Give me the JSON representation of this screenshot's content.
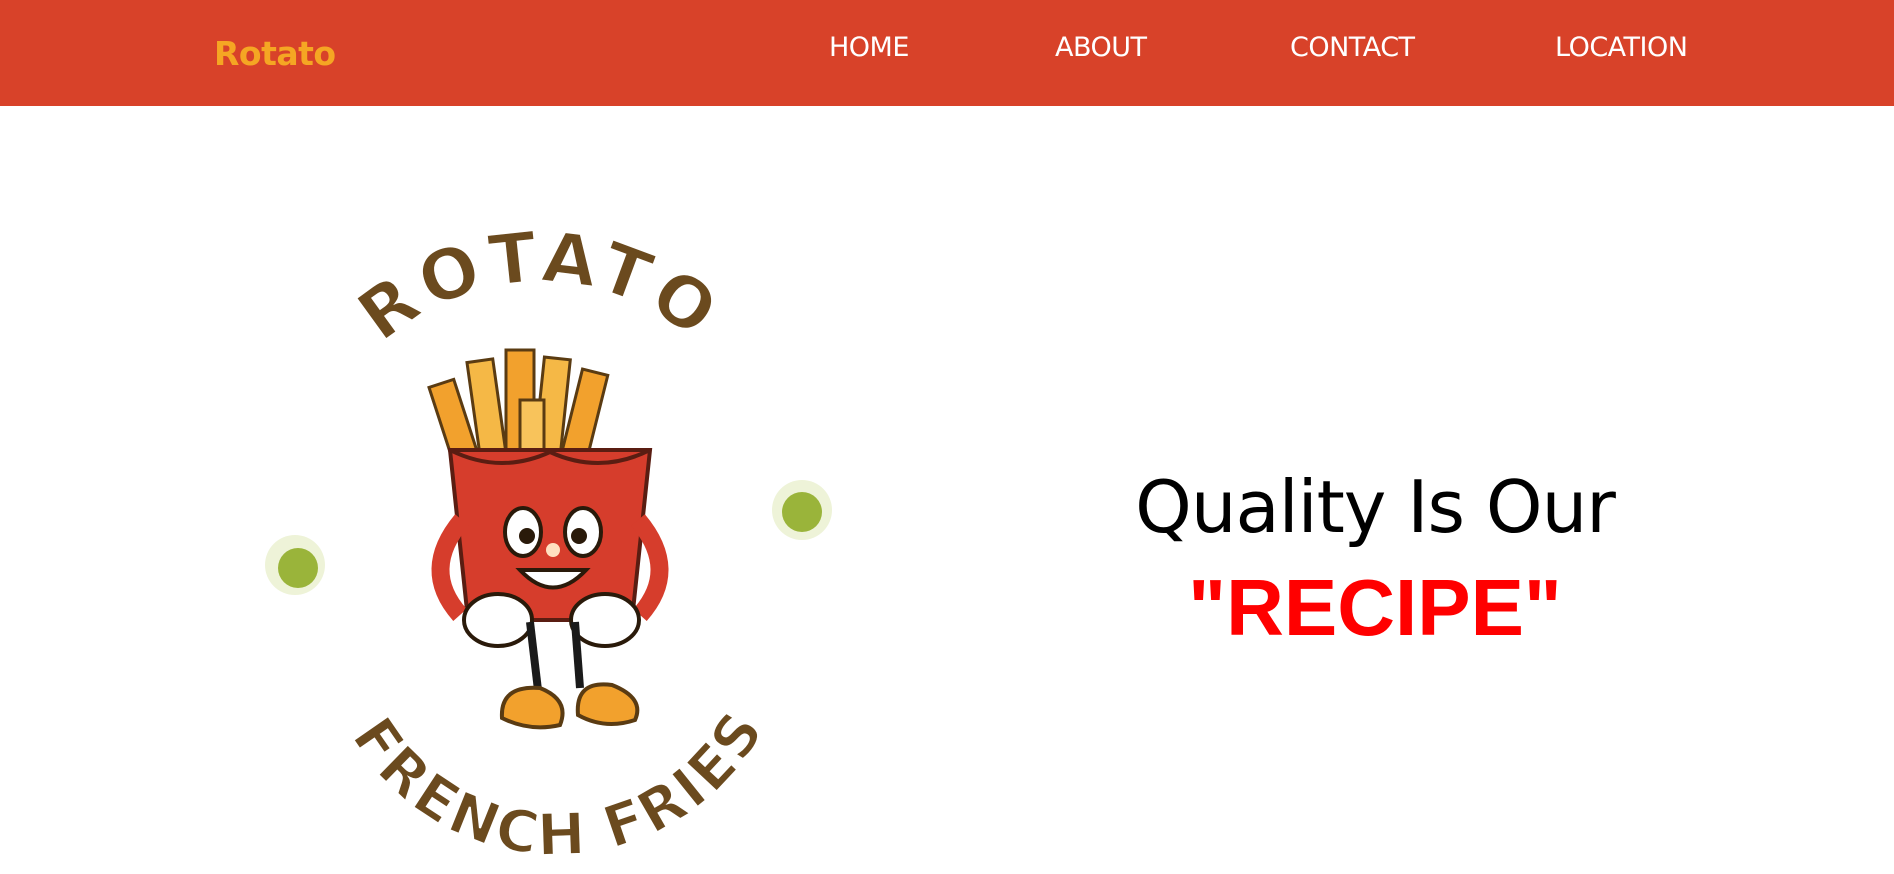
{
  "nav": {
    "brand": "Rotato",
    "links": [
      "HOME",
      "ABOUT",
      "CONTACT",
      "LOCATION"
    ]
  },
  "hero": {
    "logo": {
      "top_text": "ROTATO",
      "bottom_text": "FRENCH FRIES"
    },
    "headline": "Quality Is Our",
    "subheadline": "\"RECIPE\""
  },
  "colors": {
    "navbar": "#d84229",
    "brand": "#f5a623",
    "nav_text": "#ffffff",
    "headline": "#000000",
    "subheadline": "#ff0000",
    "logo_brown": "#6b4a1e"
  }
}
